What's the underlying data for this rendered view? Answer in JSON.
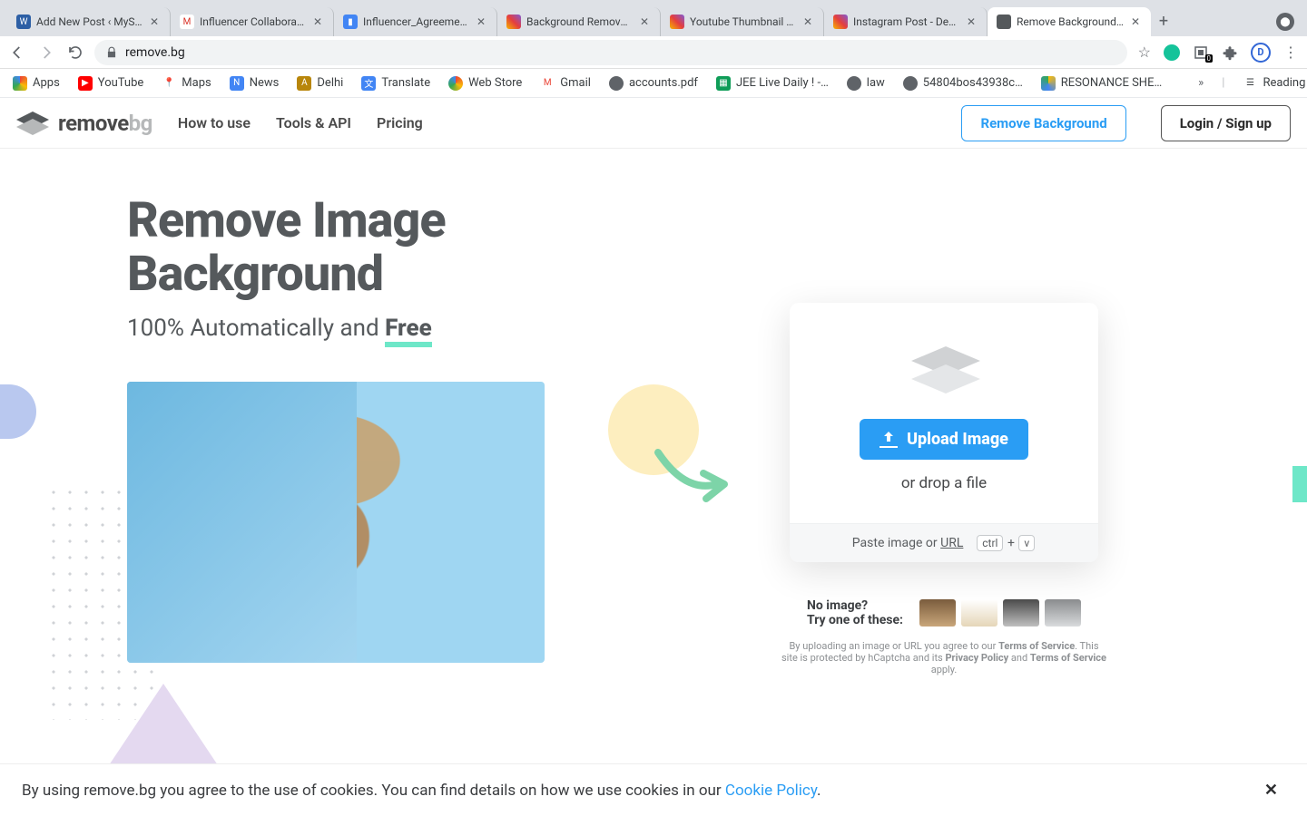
{
  "browser": {
    "tabs": [
      {
        "title": "Add New Post ‹ MyS…"
      },
      {
        "title": "Influencer Collaborati…"
      },
      {
        "title": "Influencer_Agreemen…"
      },
      {
        "title": "Background Remover…"
      },
      {
        "title": "Youtube Thumbnail - …"
      },
      {
        "title": "Instagram Post - Desi…"
      },
      {
        "title": "Remove Background f…"
      }
    ],
    "url": "remove.bg",
    "ext_count": "0",
    "bookmarks": [
      {
        "label": "Apps"
      },
      {
        "label": "YouTube"
      },
      {
        "label": "Maps"
      },
      {
        "label": "News"
      },
      {
        "label": "Delhi"
      },
      {
        "label": "Translate"
      },
      {
        "label": "Web Store"
      },
      {
        "label": "Gmail"
      },
      {
        "label": "accounts.pdf"
      },
      {
        "label": "JEE Live Daily ! -…"
      },
      {
        "label": "law"
      },
      {
        "label": "54804bos43938c…"
      },
      {
        "label": "RESONANCE SHE…"
      }
    ],
    "reading_list": "Reading List"
  },
  "header": {
    "logo_main": "remove",
    "logo_bg": "bg",
    "nav": {
      "howto": "How to use",
      "tools": "Tools & API",
      "pricing": "Pricing"
    },
    "cta_primary": "Remove Background",
    "cta_secondary": "Login / Sign up"
  },
  "hero": {
    "title_l1": "Remove Image",
    "title_l2": "Background",
    "sub_prefix": "100% Automatically and ",
    "sub_free": "Free"
  },
  "upload": {
    "button": "Upload Image",
    "drop": "or drop a file",
    "paste_prefix": "Paste image or ",
    "url": "URL",
    "kbd1": "ctrl",
    "plus": "+",
    "kbd2": "v"
  },
  "try": {
    "l1": "No image?",
    "l2": "Try one of these:"
  },
  "legal": {
    "t1": "By uploading an image or URL you agree to our ",
    "tos": "Terms of Service",
    "t2": ". This site is protected by hCaptcha and its ",
    "pp": "Privacy Policy",
    "t3": " and ",
    "tos2": "Terms of Service",
    "t4": " apply."
  },
  "cookie": {
    "text": "By using remove.bg you agree to the use of cookies. You can find details on how we use cookies in our ",
    "link": "Cookie Policy",
    "dot": "."
  }
}
